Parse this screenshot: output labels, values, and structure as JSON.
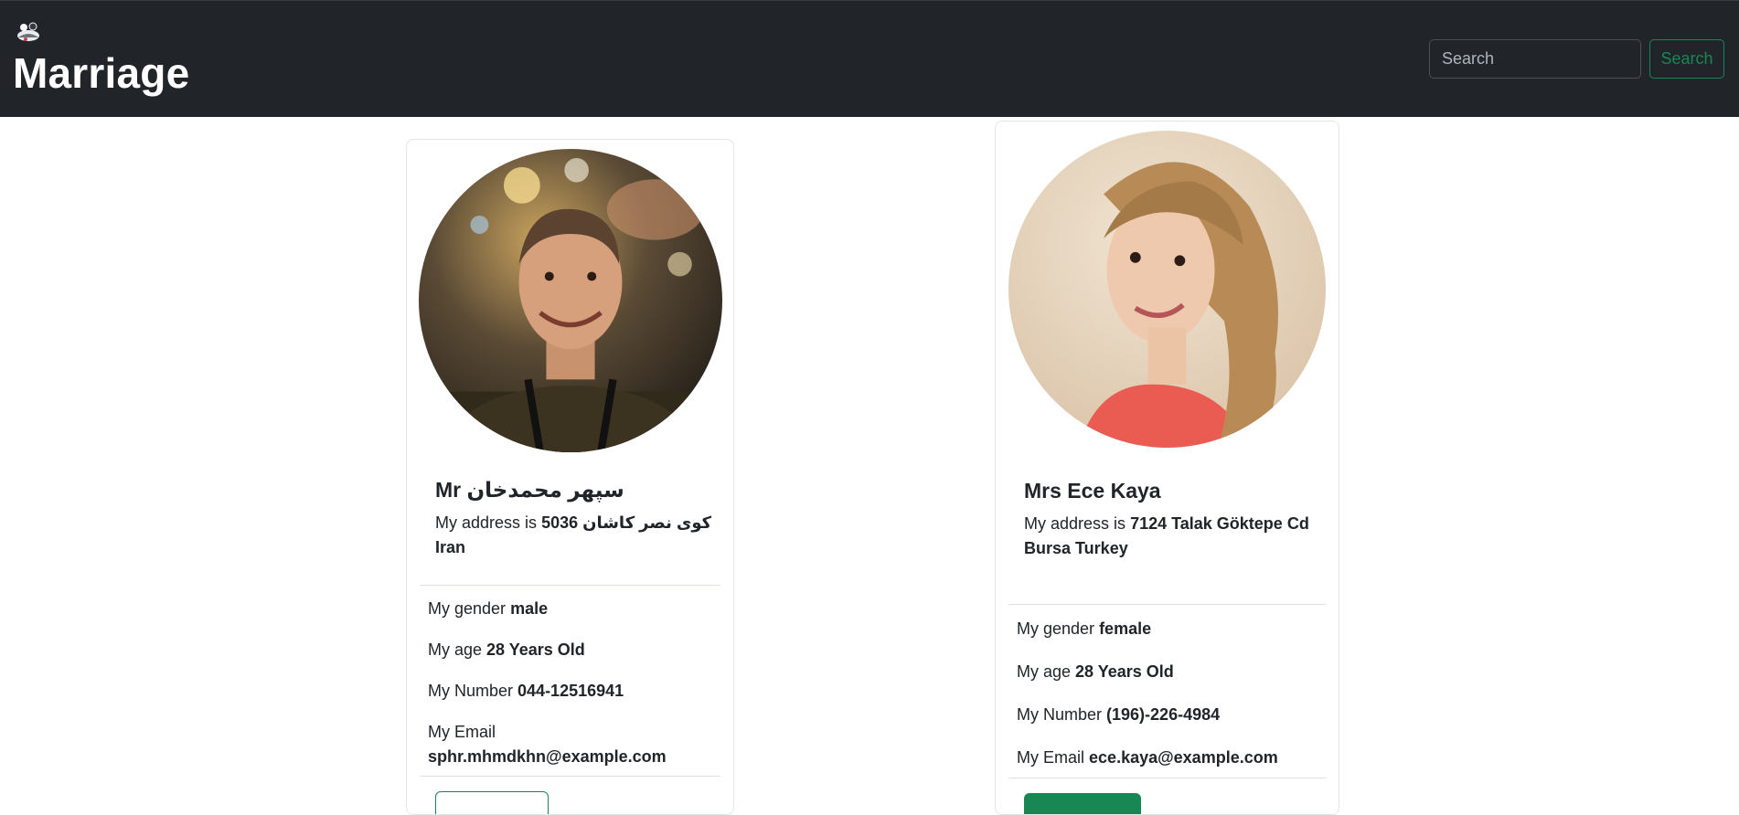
{
  "navbar": {
    "logo_icon": "couple-logo-icon",
    "title": "Marriage",
    "search_placeholder": "Search",
    "search_button_label": "Search",
    "accent_color": "#198754",
    "background_color": "#212529"
  },
  "profiles": [
    {
      "title": "Mr",
      "name": "سپهر محمدخان",
      "address_label": "My address is",
      "address_value": "5036 کوی نصر کاشان Iran",
      "gender_label": "My gender",
      "gender": "male",
      "age_label": "My age",
      "age": "28 Years Old",
      "number_label": "My Number",
      "number": "044-12516941",
      "email_label": "My Email",
      "email": "sphr.mhmdkhn@example.com"
    },
    {
      "title": "Mrs",
      "name": "Ece Kaya",
      "address_label": "My address is",
      "address_value": "7124 Talak Göktepe Cd Bursa Turkey",
      "gender_label": "My gender",
      "gender": "female",
      "age_label": "My age",
      "age": "28 Years Old",
      "number_label": "My Number",
      "number": "(196)-226-4984",
      "email_label": "My Email",
      "email": "ece.kaya@example.com"
    }
  ]
}
